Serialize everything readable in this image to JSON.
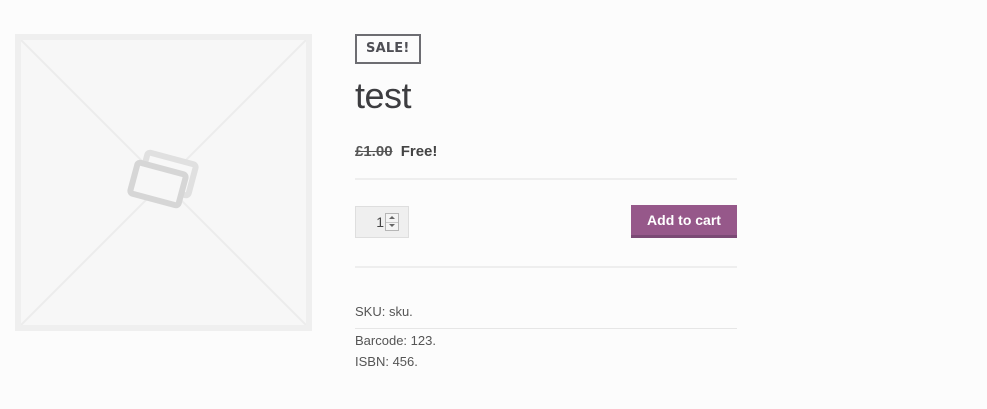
{
  "product": {
    "title": "test",
    "sale_badge": "SALE!",
    "price": {
      "regular": "£1.00",
      "sale": "Free!"
    },
    "quantity": "1",
    "add_to_cart_label": "Add to cart",
    "meta": {
      "sku": "SKU: sku.",
      "barcode": "Barcode: 123.",
      "isbn": "ISBN: 456."
    },
    "image_icon": "image-placeholder-icon"
  },
  "colors": {
    "button": "#96588a",
    "badge_border": "#6d6d72",
    "background": "#fcfcfc"
  }
}
